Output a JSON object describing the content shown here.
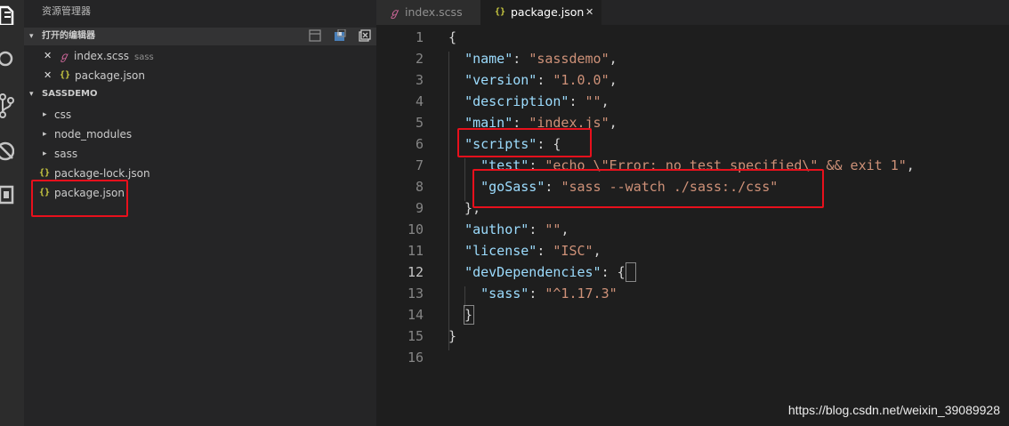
{
  "explorer": {
    "title": "资源管理器",
    "open_editors_header": "打开的编辑器",
    "open_editors": [
      {
        "close": "✕",
        "icon": "sass-file-icon",
        "name": "index.scss",
        "desc": "sass"
      },
      {
        "close": "✕",
        "icon": "json-file-icon",
        "name": "package.json",
        "desc": ""
      }
    ],
    "project_header": "SASSDEMO",
    "tree": [
      {
        "type": "folder",
        "name": "css"
      },
      {
        "type": "folder",
        "name": "node_modules"
      },
      {
        "type": "folder",
        "name": "sass"
      },
      {
        "type": "file",
        "name": "package-lock.json"
      },
      {
        "type": "file",
        "name": "package.json"
      }
    ],
    "json_icon_text": "{}"
  },
  "tabs": [
    {
      "name": "index.scss",
      "icon": "sass-file-icon",
      "active": false
    },
    {
      "name": "package.json",
      "icon": "json-file-icon",
      "active": true,
      "close": "✕"
    }
  ],
  "editor": {
    "active_line": 12,
    "line_numbers": [
      "1",
      "2",
      "3",
      "4",
      "5",
      "6",
      "7",
      "8",
      "9",
      "10",
      "11",
      "12",
      "13",
      "14",
      "15",
      "16"
    ],
    "lines": [
      "{",
      "  \"name\": \"sassdemo\",",
      "  \"version\": \"1.0.0\",",
      "  \"description\": \"\",",
      "  \"main\": \"index.js\",",
      "  \"scripts\": {",
      "    \"test\": \"echo \\\"Error: no test specified\\\" && exit 1\",",
      "    \"goSass\": \"sass --watch ./sass:./css\"",
      "  },",
      "  \"author\": \"\",",
      "  \"license\": \"ISC\",",
      "  \"devDependencies\": {",
      "    \"sass\": \"^1.17.3\"",
      "  }",
      "}",
      ""
    ]
  },
  "colors": {
    "key": "#9cdcfe",
    "string": "#ce9178",
    "highlight_box": "#e8101c",
    "sass_icon": "#cd6799",
    "json_icon": "#cbcb41"
  },
  "watermark": "https://blog.csdn.net/weixin_39089928"
}
